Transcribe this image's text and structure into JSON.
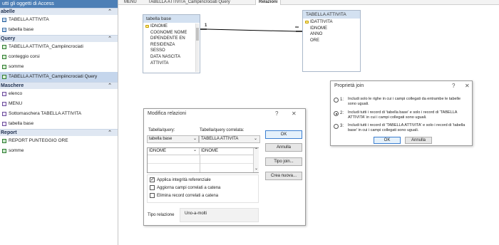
{
  "nav": {
    "header": "utti gli oggetti di Access",
    "groups": [
      {
        "label": "abelle",
        "items": [
          "TABELLA ATTIVITA",
          "tabella base"
        ]
      },
      {
        "label": "Query",
        "items": [
          "TABELLA ATTIVITA_Campiincrociati",
          "conteggio corsi",
          "somme",
          "TABELLA ATTIVITA_Campiincrociati Query"
        ]
      },
      {
        "label": "Maschere",
        "items": [
          "elenco",
          "MENU",
          "Sottomaschera TABELLA ATTIVITA",
          "tabella base"
        ]
      },
      {
        "label": "Report",
        "items": [
          "REPORT PUNTEGGIO ORE",
          "somme"
        ]
      }
    ]
  },
  "tabs": [
    "MENU",
    "TABELLA ATTIVITA_Campiincrociati Query",
    "Relazioni"
  ],
  "design": {
    "table_base": {
      "title": "tabella base",
      "fields": [
        "IDNOME",
        "COGNOME NOME",
        "DIPENDENTE EN",
        "RESIDENZA",
        "SESSO",
        "DATA NASCITA",
        "ATTIVITA"
      ]
    },
    "table_attivita": {
      "title": "TABELLA ATTIVITA",
      "fields": [
        "IDATTIVITA",
        "IDNOME",
        "ANNO",
        "ORE"
      ]
    },
    "rel_one": "1",
    "rel_many": "∞"
  },
  "edit_dialog": {
    "title": "Modifica relazioni",
    "help": "?",
    "close": "✕",
    "table_label": "Tabella/query:",
    "related_label": "Tabella/query correlata:",
    "table_value": "tabella base",
    "related_value": "TABELLA ATTIVITA",
    "field_left": "IDNOME",
    "field_right": "IDNOME",
    "check_integrity": "Applica integrità referenziale",
    "check_update": "Aggiorna campi correlati a catena",
    "check_delete": "Elimina record correlati a catena",
    "reltype_label": "Tipo relazione",
    "reltype_value": "Uno-a-molti",
    "btn_ok": "OK",
    "btn_cancel": "Annulla",
    "btn_join": "Tipo join...",
    "btn_new": "Crea nuova..."
  },
  "join_dialog": {
    "title": "Proprietà join",
    "help": "?",
    "close": "✕",
    "options": [
      {
        "num": "1:",
        "text": "Includi solo le righe in cui i campi collegati da entrambe le tabelle sono uguali."
      },
      {
        "num": "2:",
        "text": "Includi tutti i record di 'tabella base' e solo i record di 'TABELLA ATTIVITA' in cui i campi collegati sono uguali."
      },
      {
        "num": "3:",
        "text": "Includi tutti i record di 'TABELLA ATTIVITA' e solo i record di 'tabella base' in cui i campi collegati sono uguali."
      }
    ],
    "selected_option": 2,
    "btn_ok": "OK",
    "btn_cancel": "Annulla"
  }
}
